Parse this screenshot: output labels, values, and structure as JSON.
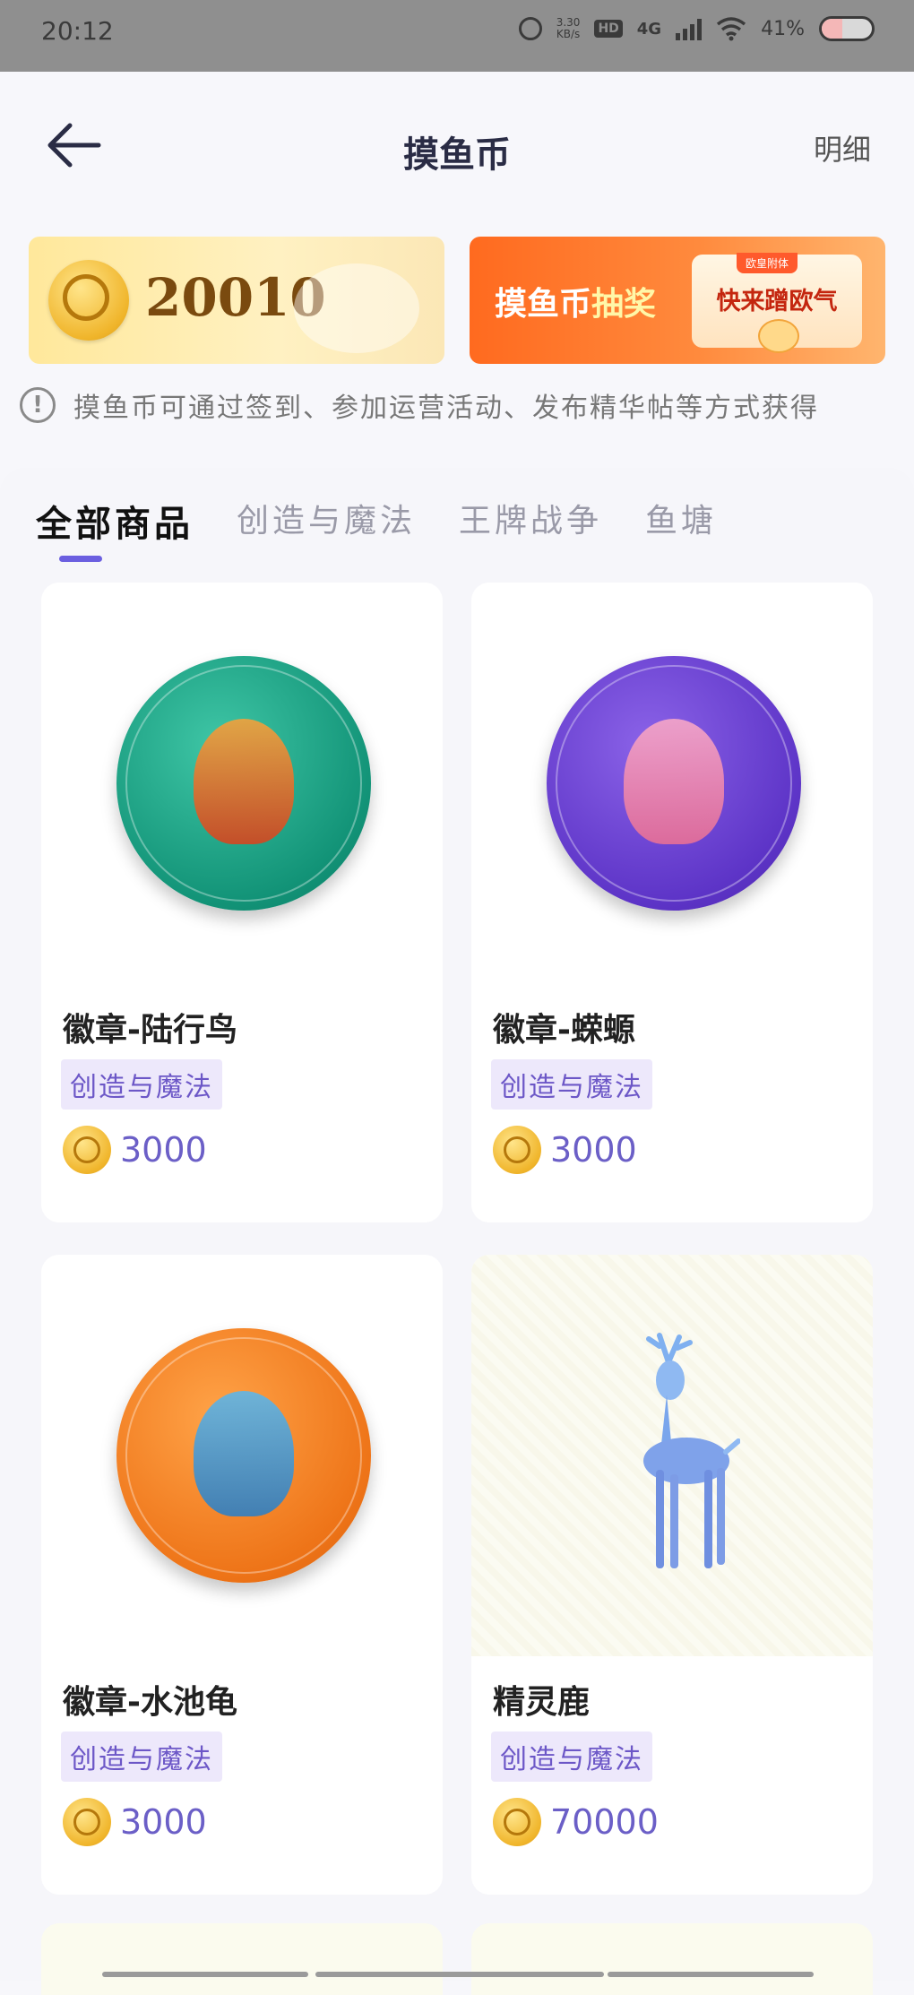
{
  "status_bar": {
    "time": "20:12",
    "net_speed_value": "3.30",
    "net_speed_unit": "KB/s",
    "hd": "HD",
    "signal": "4G",
    "battery": "41%",
    "battery_level": 0.41
  },
  "header": {
    "title": "摸鱼币",
    "detail_label": "明细"
  },
  "banners": {
    "coin_balance": "20010",
    "lottery_title_prefix": "摸鱼币",
    "lottery_title_highlight": "抽奖",
    "lottery_tag": "欧皇附体",
    "lottery_cta": "快来蹭欧气"
  },
  "info_text": "摸鱼币可通过签到、参加运营活动、发布精华帖等方式获得",
  "tabs": [
    {
      "label": "全部商品",
      "active": true
    },
    {
      "label": "创造与魔法",
      "active": false
    },
    {
      "label": "王牌战争",
      "active": false
    },
    {
      "label": "鱼塘",
      "active": false
    }
  ],
  "products": [
    {
      "name": "徽章-陆行鸟",
      "category": "创造与魔法",
      "price": "3000"
    },
    {
      "name": "徽章-蝾螈",
      "category": "创造与魔法",
      "price": "3000"
    },
    {
      "name": "徽章-水池龟",
      "category": "创造与魔法",
      "price": "3000"
    },
    {
      "name": "精灵鹿",
      "category": "创造与魔法",
      "price": "70000"
    }
  ],
  "colors": {
    "accent": "#6b5fe0",
    "category_text": "#6c57c7",
    "category_bg": "#ede8fb",
    "lottery_orange": "#ff6a1f"
  }
}
